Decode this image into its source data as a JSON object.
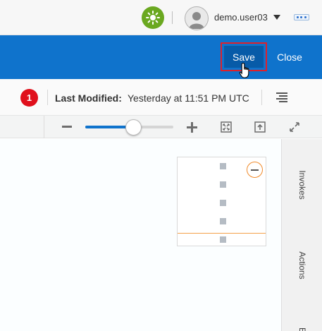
{
  "header": {
    "username": "demo.user03",
    "theme_icon": "sun-icon",
    "avatar_icon": "user-avatar-icon",
    "menu_icon": "chevron-down-icon",
    "apps_icon": "more-dots-icon"
  },
  "actionbar": {
    "save_label": "Save",
    "close_label": "Close",
    "background": "#0f73cc",
    "highlight_color": "#e0202a"
  },
  "status": {
    "error_count": "1",
    "last_modified_label": "Last Modified:",
    "last_modified_value": "Yesterday at 11:51 PM UTC"
  },
  "toolbar": {
    "zoom_fraction": 0.55
  },
  "sidepanel": {
    "tabs": [
      {
        "label": "Invokes"
      },
      {
        "label": "Actions"
      },
      {
        "label": "E"
      }
    ]
  }
}
